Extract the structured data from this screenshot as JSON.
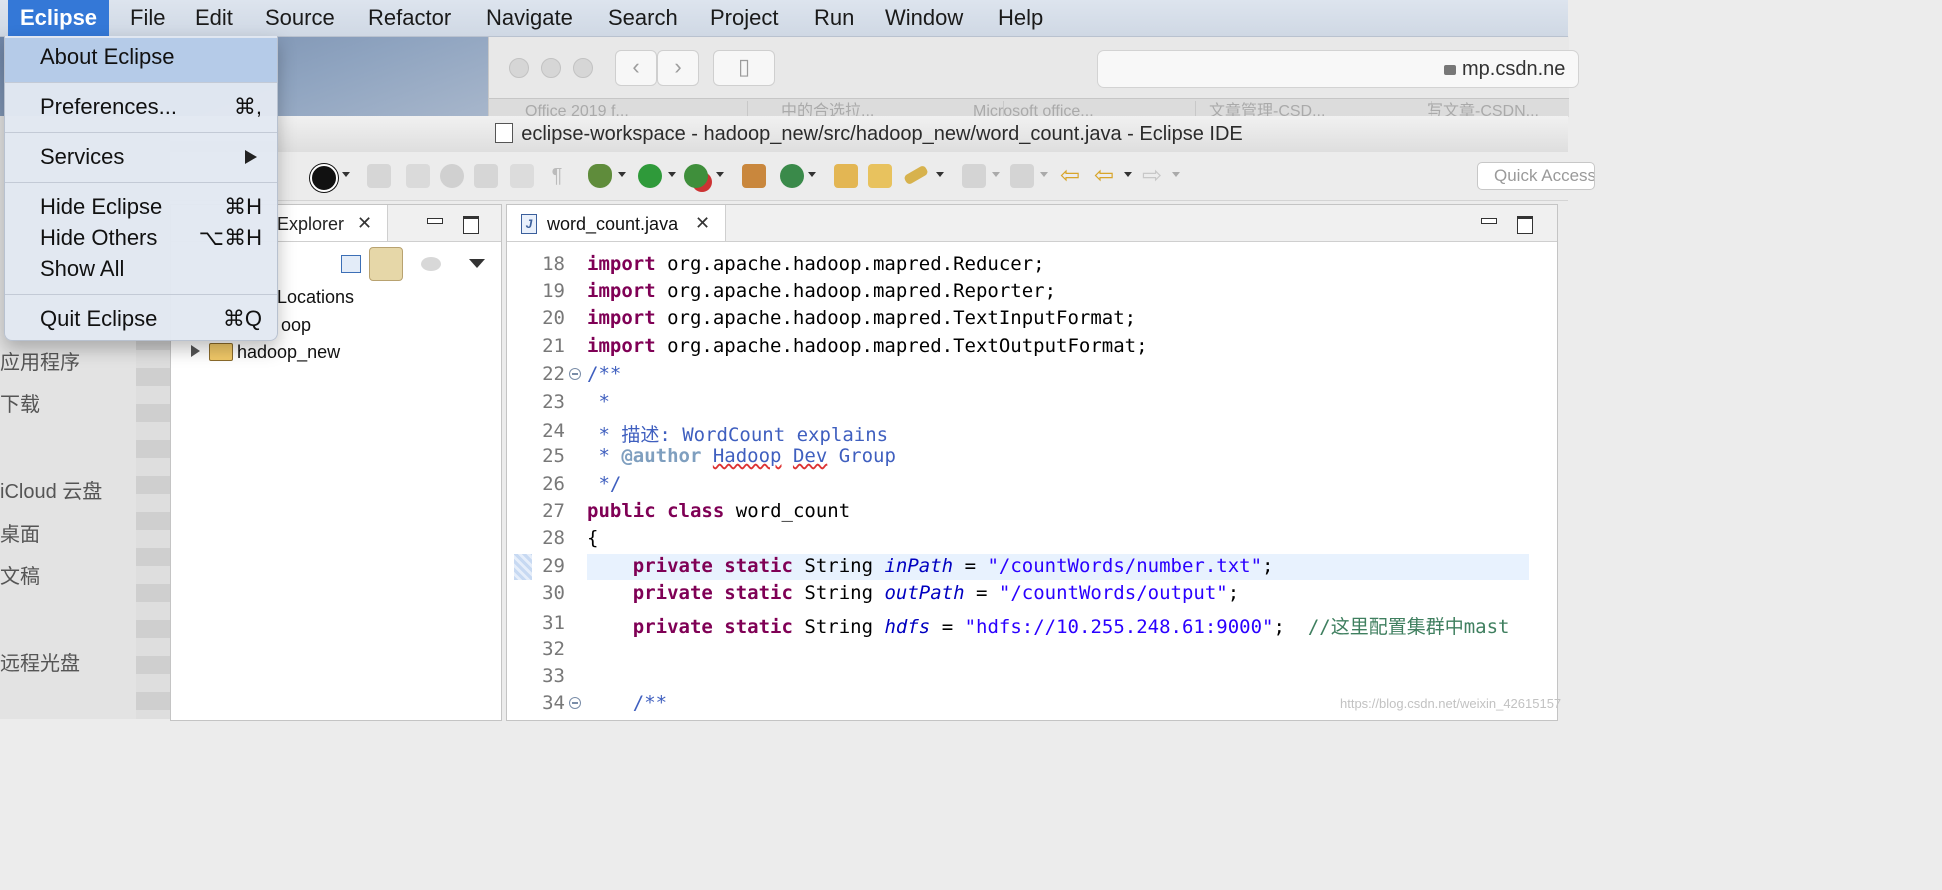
{
  "menubar": {
    "items": [
      "Eclipse",
      "File",
      "Edit",
      "Source",
      "Refactor",
      "Navigate",
      "Search",
      "Project",
      "Run",
      "Window",
      "Help"
    ]
  },
  "app_menu": {
    "about": "About Eclipse",
    "preferences": "Preferences...",
    "preferences_shortcut": "⌘,",
    "services": "Services",
    "hide_eclipse": "Hide Eclipse",
    "hide_eclipse_shortcut": "⌘H",
    "hide_others": "Hide Others",
    "hide_others_shortcut": "⌥⌘H",
    "show_all": "Show All",
    "quit": "Quit Eclipse",
    "quit_shortcut": "⌘Q"
  },
  "browser": {
    "url": "mp.csdn.ne",
    "tabs": [
      "Office 2019 f...",
      "中的合选拉...",
      "Microsoft office...",
      "文章管理-CSD...",
      "写文章-CSDN..."
    ]
  },
  "finder": {
    "items": [
      "应用程序",
      "下载",
      "iCloud 云盘",
      "桌面",
      "文稿",
      "远程光盘"
    ]
  },
  "window": {
    "title": "eclipse-workspace - hadoop_new/src/hadoop_new/word_count.java - Eclipse IDE"
  },
  "toolbar": {
    "quick_access": "Quick Access",
    "icons": [
      "user-icon",
      "debug-icon",
      "run-icon",
      "run-external-icon",
      "new-package-icon",
      "new-class-icon",
      "open-type-icon",
      "open-task-icon",
      "search-icon",
      "next-annotation-icon",
      "prev-annotation-icon",
      "last-edit-icon",
      "back-icon",
      "forward-icon"
    ]
  },
  "package_explorer": {
    "tab_label": "Explorer",
    "tree": [
      "Locations",
      "oop",
      "hadoop_new"
    ]
  },
  "editor": {
    "tab_label": "word_count.java",
    "line_numbers": [
      "18",
      "19",
      "20",
      "21",
      "22",
      "23",
      "24",
      "25",
      "26",
      "27",
      "28",
      "29",
      "30",
      "31",
      "32",
      "33",
      "34"
    ],
    "imports": [
      "org.apache.hadoop.mapred.Reducer;",
      "org.apache.hadoop.mapred.Reporter;",
      "org.apache.hadoop.mapred.TextInputFormat;",
      "org.apache.hadoop.mapred.TextOutputFormat;"
    ],
    "kw_import": "import",
    "kw_public": "public",
    "kw_class": "class",
    "kw_private": "private",
    "kw_static": "static",
    "doc_open": "/**",
    "doc_star": " *",
    "doc_desc": " * 描述: WordCount explains",
    "doc_author_star": " * ",
    "doc_author_tag": "@author",
    "doc_author_name1": "Hadoop",
    "doc_author_name2": "Dev",
    "doc_author_name3": "Group",
    "doc_close": " */",
    "class_name": "word_count",
    "brace": "{",
    "type_string": "String",
    "fields": [
      {
        "name": "inPath",
        "value": "\"/countWords/number.txt\""
      },
      {
        "name": "outPath",
        "value": "\"/countWords/output\""
      },
      {
        "name": "hdfs",
        "value": "\"hdfs://10.255.248.61:9000\""
      }
    ],
    "eq": "=",
    "semi": ";",
    "line_comment": "//这里配置集群中mast",
    "doc_open_indented": "/**"
  },
  "watermark": "https://blog.csdn.net/weixin_42615157"
}
